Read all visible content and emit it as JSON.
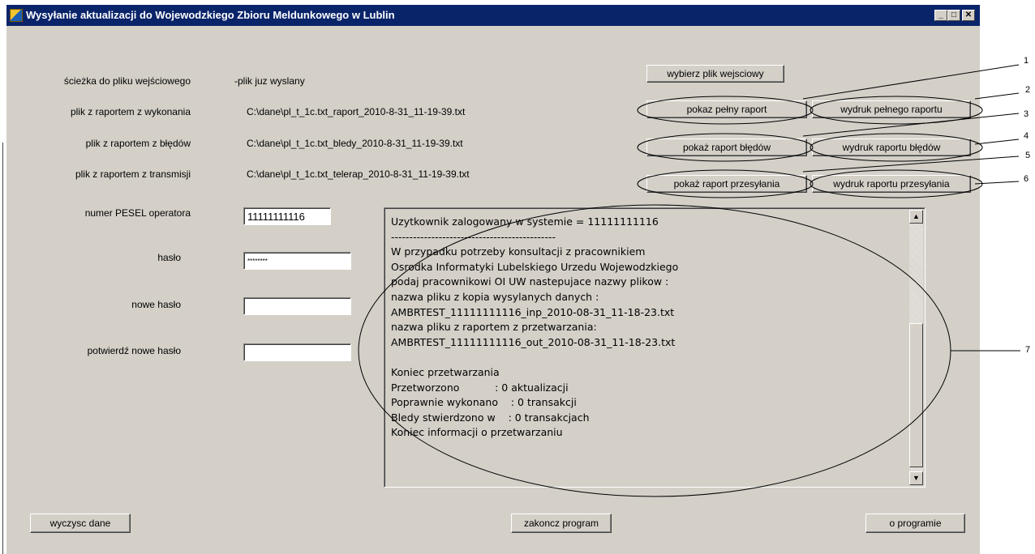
{
  "window": {
    "title": "Wysyłanie aktualizacji do Wojewodzkiego Zbioru Meldunkowego w Lublin",
    "minimize": "_",
    "maximize": "□",
    "close": "✕"
  },
  "fields": {
    "input_path_label": "ścieżka do pliku wejściowego",
    "input_path_value": "-plik juz wyslany",
    "report_label": "plik z raportem z wykonania",
    "report_value": "C:\\dane\\pl_t_1c.txt_raport_2010-8-31_11-19-39.txt",
    "errors_label": "plik z raportem z błędów",
    "errors_value": "C:\\dane\\pl_t_1c.txt_bledy_2010-8-31_11-19-39.txt",
    "transmission_label": "plik z raportem z transmisji",
    "transmission_value": "C:\\dane\\pl_t_1c.txt_telerap_2010-8-31_11-19-39.txt",
    "pesel_label": "numer PESEL operatora",
    "pesel_value": "11111111116",
    "password_label": "hasło",
    "password_value": "********",
    "new_password_label": "nowe hasło",
    "new_password_value": "",
    "confirm_password_label": "potwierdź nowe hasło",
    "confirm_password_value": ""
  },
  "buttons": {
    "choose_file": "wybierz plik wejsciowy",
    "show_full_report": "pokaz pełny raport",
    "print_full_report": "wydruk pełnego raportu",
    "show_error_report": "pokaż raport błędów",
    "print_error_report": "wydruk raportu błędów",
    "show_transfer_report": "pokaż raport przesyłania",
    "print_transfer_report": "wydruk raportu przesyłania",
    "clear_data": "wyczysc dane",
    "end_program": "zakoncz program",
    "about": "o programie"
  },
  "log": {
    "text": "Uzytkownik zalogowany w systemie = 11111111116\n---------------------------------------------\nW przypadku potrzeby konsultacji z pracownikiem\nOsrodka Informatyki Lubelskiego Urzedu Wojewodzkiego\npodaj pracownikowi OI UW nastepujace nazwy plikow :\nnazwa pliku z kopia wysylanych danych :\nAMBRTEST_11111111116_inp_2010-08-31_11-18-23.txt\nnazwa pliku z raportem z przetwarzania:\nAMBRTEST_11111111116_out_2010-08-31_11-18-23.txt\n\nKoniec przetwarzania\nPrzetworzono           : 0 aktualizacji\nPoprawnie wykonano    : 0 transakcji\nBledy stwierdzono w    : 0 transakcjach\nKoniec informacji o przetwarzaniu",
    "scroll_up": "▲",
    "scroll_down": "▼"
  },
  "annotations": [
    "1",
    "2",
    "3",
    "4",
    "5",
    "6",
    "7"
  ]
}
